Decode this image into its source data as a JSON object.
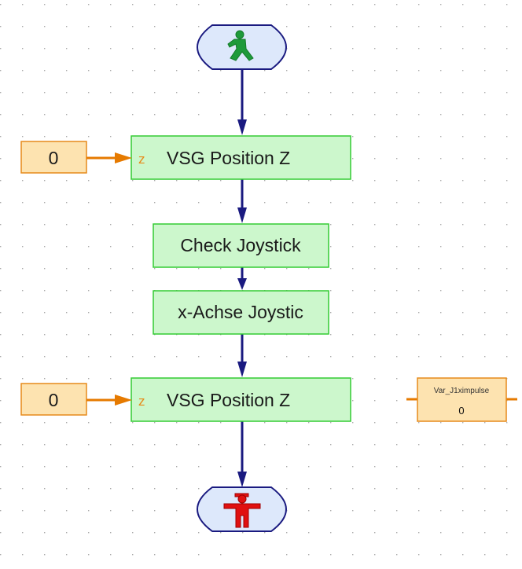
{
  "colors": {
    "block_fill": "#ccf7cc",
    "block_border": "#33cc33",
    "constant_fill": "#fde3b0",
    "constant_border": "#e68a1a",
    "flow_line": "#1a1a80",
    "data_line": "#e67a00",
    "start_icon": "#1e9a3a",
    "stop_icon": "#e01010"
  },
  "start": {
    "icon": "green-walking-man-icon"
  },
  "stop": {
    "icon": "red-standing-man-icon"
  },
  "blocks": [
    {
      "label": "VSG Position Z",
      "input_port": "z",
      "constant": "0"
    },
    {
      "label": "Check Joystick"
    },
    {
      "label": "x-Achse Joystic"
    },
    {
      "label": "VSG Position Z",
      "input_port": "z",
      "constant": "0"
    }
  ],
  "variable": {
    "name": "Var_J1ximpulse",
    "value": "0"
  }
}
